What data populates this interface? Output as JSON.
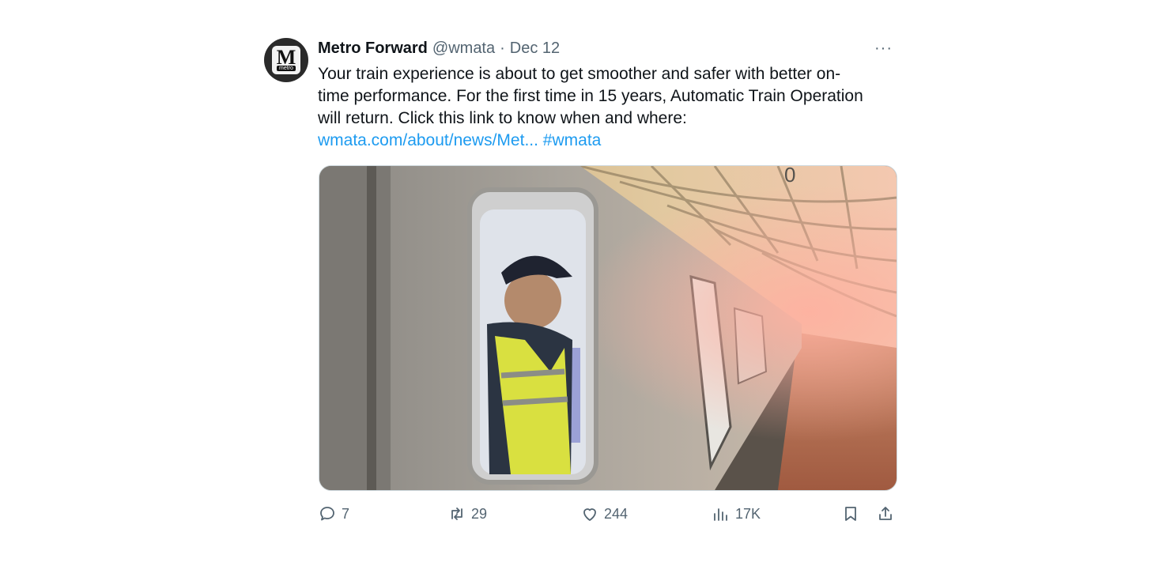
{
  "author": {
    "name": "Metro Forward",
    "handle": "@wmata",
    "separator": "·",
    "date": "Dec 12",
    "avatar_letter": "M",
    "avatar_sub": "metro"
  },
  "more_label": "···",
  "tweet": {
    "line1": "Your train experience is about to get smoother and safer with better on-",
    "line2": "time performance. For the first time in 15 years, Automatic Train Operation",
    "line3": "will return. Click this link to know when and where:",
    "link": "wmata.com/about/news/Met...",
    "hashtag": "#wmata"
  },
  "media": {
    "alt_icon": "photo-train-operator",
    "train_number": "0"
  },
  "actions": {
    "replies": "7",
    "retweets": "29",
    "likes": "244",
    "views": "17K"
  },
  "colors": {
    "text": "#0f1419",
    "muted": "#536471",
    "link": "#1d9bf0",
    "border": "#cfd9de"
  }
}
